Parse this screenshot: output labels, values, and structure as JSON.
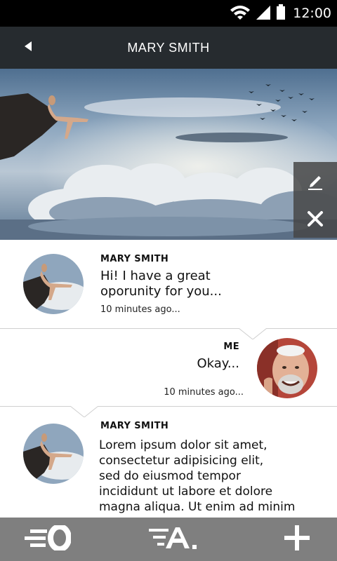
{
  "status_bar": {
    "time": "12:00"
  },
  "header": {
    "title": "MARY SMITH"
  },
  "messages": [
    {
      "sender": "MARY SMITH",
      "lines": [
        "Hi! I have a great",
        "oporunity for you..."
      ],
      "time": "10 minutes ago..."
    },
    {
      "sender": "ME",
      "lines": [
        "Okay..."
      ],
      "time": "10 minutes ago..."
    },
    {
      "sender": "MARY SMITH",
      "lines": [
        "Lorem ipsum dolor sit amet,",
        "consectetur adipisicing elit,",
        "sed do eiusmod tempor",
        "incididunt ut labore et dolore",
        "magna aliqua. Ut enim ad minim"
      ]
    }
  ],
  "colors": {
    "status_bar": "#000000",
    "header": "#262b2f",
    "bottom_nav": "#7f7f7f",
    "action_panel": "#464646"
  },
  "icons": {
    "header": [
      "back-arrow-icon"
    ],
    "hero_actions": [
      "edit-pencil-icon",
      "close-icon"
    ],
    "bottom_nav": [
      "speed-zero-icon",
      "filter-a-icon",
      "plus-icon"
    ]
  }
}
